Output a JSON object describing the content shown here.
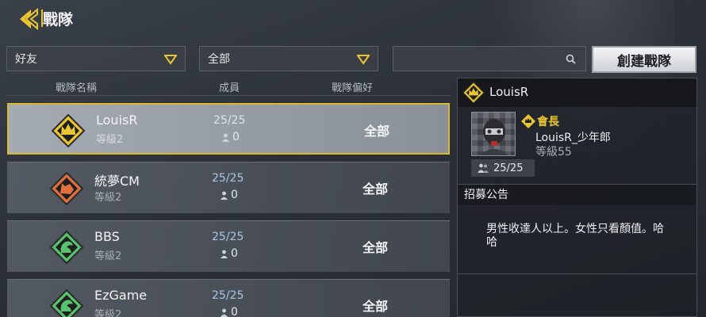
{
  "header": {
    "title": "戰隊"
  },
  "filters": {
    "relation": {
      "selected": "好友"
    },
    "preference": {
      "selected": "全部"
    },
    "search": {
      "value": "",
      "placeholder": ""
    },
    "create_label": "創建戰隊"
  },
  "columns": {
    "name": "戰隊名稱",
    "members": "成員",
    "preference": "戰隊偏好"
  },
  "rows": [
    {
      "name": "LouisR",
      "level": "等級2",
      "members": "25/25",
      "pending": "0",
      "preference": "全部",
      "emblem": "crown-emblem-icon",
      "color": "#e8c531"
    },
    {
      "name": "統夢CM",
      "level": "等級2",
      "members": "25/25",
      "pending": "0",
      "preference": "全部",
      "emblem": "wolf-emblem-icon",
      "color": "#e0713f"
    },
    {
      "name": "BBS",
      "level": "等級2",
      "members": "25/25",
      "pending": "0",
      "preference": "全部",
      "emblem": "dragon-emblem-icon",
      "color": "#58c36d"
    },
    {
      "name": "EzGame",
      "level": "等級2",
      "members": "25/25",
      "pending": "0",
      "preference": "全部",
      "emblem": "dragon-emblem-icon",
      "color": "#58c36d"
    }
  ],
  "detail": {
    "name": "LouisR",
    "leader_label": "會長",
    "leader_name": "LouisR_少年郎",
    "leader_level": "等級55",
    "member_count": "25/25",
    "recruit_title": "招募公告",
    "recruit_text": "男性收達人以上。女性只看顏值。哈哈"
  },
  "colors": {
    "accent": "#e8c531",
    "selected_border": "#d9b833"
  }
}
